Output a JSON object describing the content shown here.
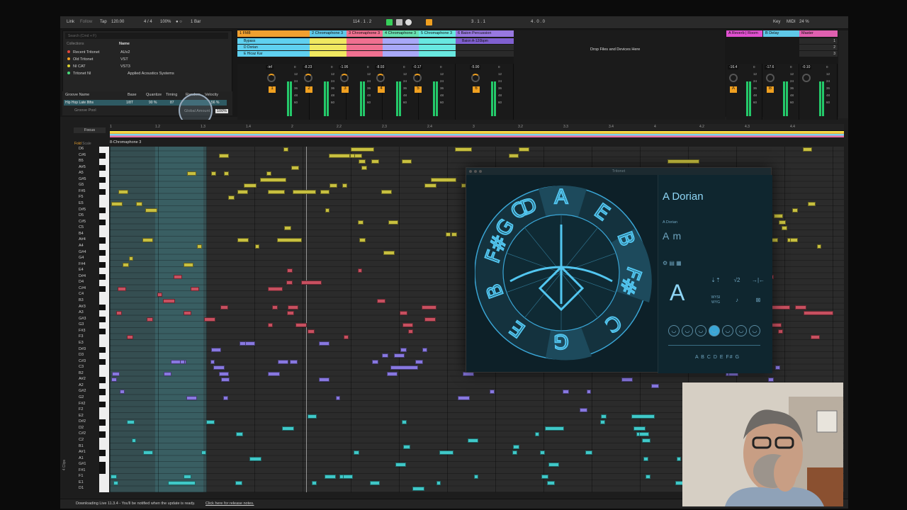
{
  "toolbar": {
    "link": "Link",
    "follow": "Follow",
    "tap": "Tap",
    "tempo": "120.00",
    "meter": "4 / 4",
    "zoom": "100%",
    "metro": "● ○",
    "quant": "1 Bar",
    "position": "114 . 1 . 2",
    "loop_start": "3 . 1 . 1",
    "loop_len": "4 . 0 . 0",
    "key": "Key",
    "midi": "MIDI",
    "cpu": "24 %"
  },
  "browser": {
    "search_placeholder": "Search (Cmd + F)",
    "collections_header": "Collections",
    "collections": [
      {
        "label": "Recent Tritonet",
        "color": "#e0453a"
      },
      {
        "label": "Old Tritonet",
        "color": "#f0a020"
      },
      {
        "label": "NI CAT",
        "color": "#d8d030"
      },
      {
        "label": "Tritonet NI",
        "color": "#48d878"
      }
    ],
    "name_header": "Name",
    "names": [
      "AUv2",
      "VST",
      "VST3",
      "Applied Acoustics Systems"
    ]
  },
  "groove": {
    "headers": [
      "Groove Name",
      "Base",
      "Quantize",
      "Timing",
      "Random",
      "Velocity"
    ],
    "row": {
      "name": "Hip Hop Late 8ths",
      "base": "1/8T",
      "quantize": "90 %",
      "timing": "87",
      "random": "",
      "velocity": "56 %"
    },
    "pool_label": "Groove Pool",
    "global_label": "Global Amount",
    "global_value": "100%"
  },
  "tracks": [
    {
      "title": "1 FM8",
      "color": "#f0a030",
      "clips": [
        "Bypass",
        "D Dorian",
        "E Hicaz Kar"
      ],
      "clip_color": "#5fd0f0",
      "vol": "-inf",
      "num": "1"
    },
    {
      "title": "2 Chromaphone 3",
      "color": "#5fc8e8",
      "clips": [
        "",
        "",
        ""
      ],
      "clip_color": "#f0e860",
      "vol": "-8.23",
      "num": "2"
    },
    {
      "title": "3 Chromaphone 3",
      "color": "#f07090",
      "clips": [
        "",
        "",
        ""
      ],
      "clip_color": "#f07090",
      "vol": "-1.95",
      "num": "3"
    },
    {
      "title": "4 Chromaphone 3",
      "color": "#68e0b0",
      "clips": [
        "",
        "",
        ""
      ],
      "clip_color": "#a8a8f8",
      "vol": "-8.93",
      "num": "4"
    },
    {
      "title": "5 Chromaphone 3",
      "color": "#68e8e0",
      "clips": [
        "",
        "",
        ""
      ],
      "clip_color": "#68e8e0",
      "vol": "-0.17",
      "num": "5"
    },
    {
      "title": "6 Baion Percussion",
      "color": "#9878e0",
      "clips": [
        "Baion A-120bpm",
        "",
        ""
      ],
      "clip_color": "#8060d0",
      "vol": "-5.90",
      "num": "6"
    }
  ],
  "drop_zone": "Drop Files and Devices Here",
  "returns": [
    {
      "title": "A Reverb | Room",
      "color": "#e050d0",
      "vol": "-16.4",
      "num": "A"
    },
    {
      "title": "B Delay",
      "color": "#5fc8e8",
      "vol": "-17.6",
      "num": "B"
    },
    {
      "title": "Master",
      "color": "#e060b0",
      "vol": "-0.10",
      "num": "",
      "slots": [
        "1",
        "2",
        "3"
      ]
    }
  ],
  "editor": {
    "focus": "Focus",
    "fold": "Fold",
    "scale": "Scale",
    "clip_name": "8-Chromaphone 3",
    "ruler": [
      "1",
      "1.2",
      "1.3",
      "1.4",
      "2",
      "2.2",
      "2.3",
      "2.4",
      "3",
      "3.2",
      "3.3",
      "3.4",
      "4",
      "4.2",
      "4.3",
      "4.4"
    ],
    "side_label": "4 Clips",
    "keys": [
      "D6",
      "C#6",
      "B5",
      "A#5",
      "A5",
      "G#5",
      "G5",
      "F#5",
      "F5",
      "E5",
      "D#5",
      "D5",
      "C#5",
      "C5",
      "B4",
      "A#4",
      "A4",
      "G#4",
      "G4",
      "F#4",
      "E4",
      "D#4",
      "D4",
      "C#4",
      "C4",
      "B3",
      "A#3",
      "A3",
      "G#3",
      "G3",
      "F#3",
      "F3",
      "E3",
      "D#3",
      "D3",
      "C#3",
      "C3",
      "B2",
      "A#2",
      "A2",
      "G#2",
      "G2",
      "F#2",
      "F2",
      "E2",
      "D#2",
      "D2",
      "C#2",
      "C2",
      "B1",
      "A#1",
      "A1",
      "G#1",
      "F#1",
      "F1",
      "E1",
      "D1"
    ]
  },
  "plugin": {
    "title": "Tritonet",
    "wheel_letters": [
      "A",
      "E",
      "B",
      "F#",
      "C",
      "G",
      "D"
    ],
    "scale_name": "A Dorian",
    "scale_sub": "A Dorian",
    "chord": "A m",
    "big_key": "A",
    "buttons": [
      "⇣⇡",
      "√2",
      "→|←",
      "WYSI WYG",
      "♪",
      "⊠"
    ],
    "notes": "A B C D E F# G"
  },
  "status": {
    "message": "Downloading Live 11.3.4 - You'll be notified when the update is ready.",
    "link": "Click here for release notes."
  },
  "colors": {
    "accent": "#f0a020",
    "note_yellow": "#c8c040",
    "note_red": "#c85060",
    "note_cyan": "#40c8c8",
    "note_violet": "#8878e0"
  }
}
